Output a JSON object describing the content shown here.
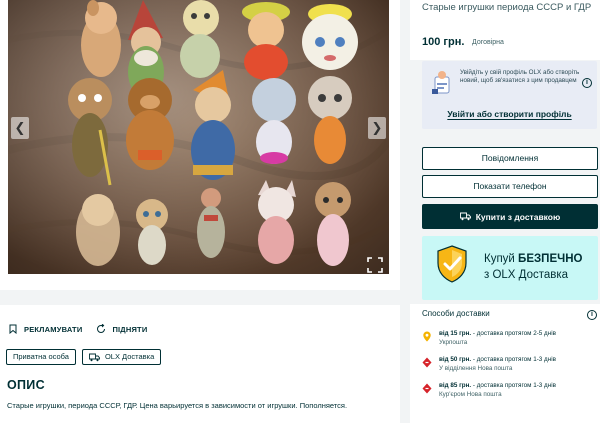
{
  "gallery": {
    "prev_icon": "chevron-left-icon",
    "next_icon": "chevron-right-icon",
    "prev_glyph": "❮",
    "next_glyph": "❯",
    "expand_icon": "expand-icon"
  },
  "ad_actions": {
    "promote_label": "РЕКЛАМУВАТИ",
    "raise_label": "ПІДНЯТИ"
  },
  "chips": {
    "private_label": "Приватна особа",
    "delivery_label": "OLX Доставка"
  },
  "description": {
    "heading": "ОПИС",
    "text": "Старые игрушки, периода СССР, ГДР. Цена варьируется в зависимости от игрушки. Пополняется."
  },
  "ad": {
    "title": "Старые игрушки периода СССР и ГДР",
    "price": "100 грн.",
    "negotiable": "Договірна"
  },
  "login": {
    "prompt": "Увійдіть у свій профіль OLX або створіть новий, щоб зв'язатися з цим продавцем",
    "link_label": "Увійти або створити профіль"
  },
  "buttons": {
    "message": "Повідомлення",
    "phone": "Показати телефон",
    "buy": "Купити з доставкою"
  },
  "safe_purchase": {
    "prefix": "Купуй ",
    "bold": "БЕЗПЕЧНО",
    "line2": "з OLX Доставка"
  },
  "delivery": {
    "title": "Способи доставки",
    "options": [
      {
        "price": "від 15 грн.",
        "desc": " - доставка протягом 2-5 днів",
        "carrier": "Укрпошта",
        "icon": "map-pin-icon"
      },
      {
        "price": "від 50 грн.",
        "desc": " - доставка протягом 1-3 днів",
        "carrier": "У відділення Нова пошта",
        "icon": "nova-poshta-icon"
      },
      {
        "price": "від 85 грн.",
        "desc": " - доставка протягом 1-3 днів",
        "carrier": "Кур'єром Нова пошта",
        "icon": "nova-poshta-icon"
      }
    ]
  },
  "colors": {
    "brand_dark": "#002f34",
    "background": "#f2f4f5",
    "safe_bg": "#c8f8f6",
    "login_bg": "#e8ecf5",
    "pin_yellow": "#f5b300",
    "np_red": "#d6232a"
  }
}
